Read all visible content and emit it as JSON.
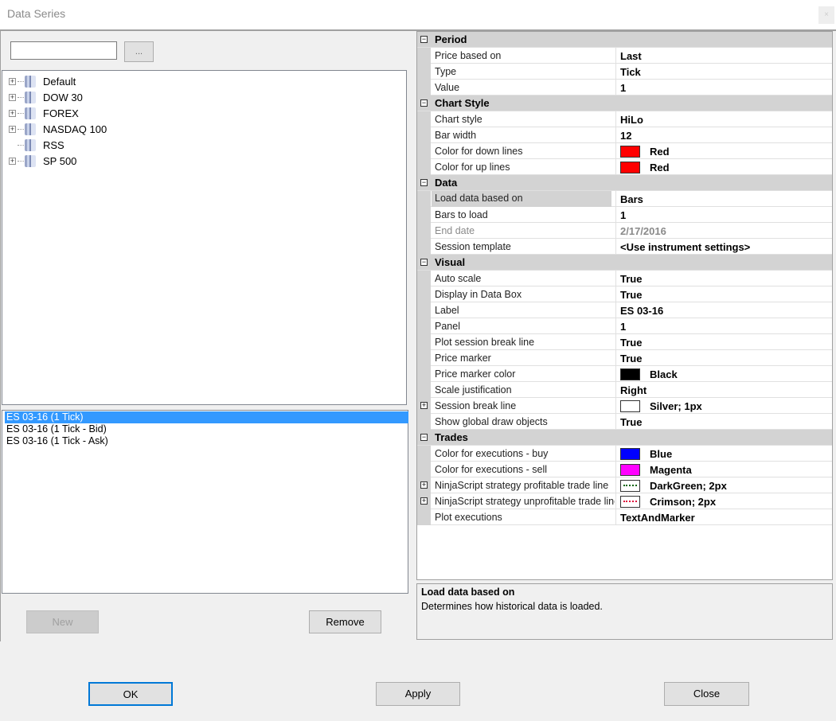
{
  "window": {
    "title": "Data Series",
    "close_label": "×"
  },
  "search": {
    "value": "",
    "browse_label": "..."
  },
  "tree": [
    {
      "label": "Default",
      "expandable": true
    },
    {
      "label": "DOW 30",
      "expandable": true
    },
    {
      "label": "FOREX",
      "expandable": true
    },
    {
      "label": "NASDAQ 100",
      "expandable": true
    },
    {
      "label": "RSS",
      "expandable": false
    },
    {
      "label": "SP 500",
      "expandable": true
    }
  ],
  "series_list": [
    {
      "label": "ES 03-16 (1 Tick)",
      "selected": true
    },
    {
      "label": "ES 03-16 (1 Tick - Bid)",
      "selected": false
    },
    {
      "label": "ES 03-16 (1 Tick - Ask)",
      "selected": false
    }
  ],
  "buttons": {
    "new": "New",
    "remove": "Remove",
    "ok": "OK",
    "apply": "Apply",
    "close": "Close"
  },
  "properties": [
    {
      "category": "Period"
    },
    {
      "name": "Price based on",
      "value": "Last"
    },
    {
      "name": "Type",
      "value": "Tick"
    },
    {
      "name": "Value",
      "value": "1"
    },
    {
      "category": "Chart Style"
    },
    {
      "name": "Chart style",
      "value": "HiLo"
    },
    {
      "name": "Bar width",
      "value": "12"
    },
    {
      "name": "Color for down lines",
      "value": "Red",
      "swatch": "#ff0000"
    },
    {
      "name": "Color for up lines",
      "value": "Red",
      "swatch": "#ff0000"
    },
    {
      "category": "Data"
    },
    {
      "name": "Load data based on",
      "value": "Bars",
      "highlight": true
    },
    {
      "name": "Bars to load",
      "value": "1"
    },
    {
      "name": "End date",
      "value": "2/17/2016",
      "disabled": true
    },
    {
      "name": "Session template",
      "value": "<Use instrument settings>"
    },
    {
      "category": "Visual"
    },
    {
      "name": "Auto scale",
      "value": "True"
    },
    {
      "name": "Display in Data Box",
      "value": "True"
    },
    {
      "name": "Label",
      "value": "ES 03-16"
    },
    {
      "name": "Panel",
      "value": "1"
    },
    {
      "name": "Plot session break line",
      "value": "True"
    },
    {
      "name": "Price marker",
      "value": "True"
    },
    {
      "name": "Price marker color",
      "value": "Black",
      "swatch": "#000000"
    },
    {
      "name": "Scale justification",
      "value": "Right"
    },
    {
      "name": "Session break line",
      "value": "Silver; 1px",
      "swatch": "#ffffff",
      "expandable": true
    },
    {
      "name": "Show global draw objects",
      "value": "True"
    },
    {
      "category": "Trades"
    },
    {
      "name": "Color for executions - buy",
      "value": "Blue",
      "swatch": "#0000ff"
    },
    {
      "name": "Color for executions - sell",
      "value": "Magenta",
      "swatch": "#ff00ff"
    },
    {
      "name": "NinjaScript strategy profitable trade line",
      "value": "DarkGreen; 2px",
      "dash": "#006400",
      "expandable": true
    },
    {
      "name": "NinjaScript strategy unprofitable trade line",
      "value": "Crimson; 2px",
      "dash": "#dc143c",
      "expandable": true
    },
    {
      "name": "Plot executions",
      "value": "TextAndMarker"
    }
  ],
  "description": {
    "title": "Load data based on",
    "text": "Determines how historical data is loaded."
  }
}
